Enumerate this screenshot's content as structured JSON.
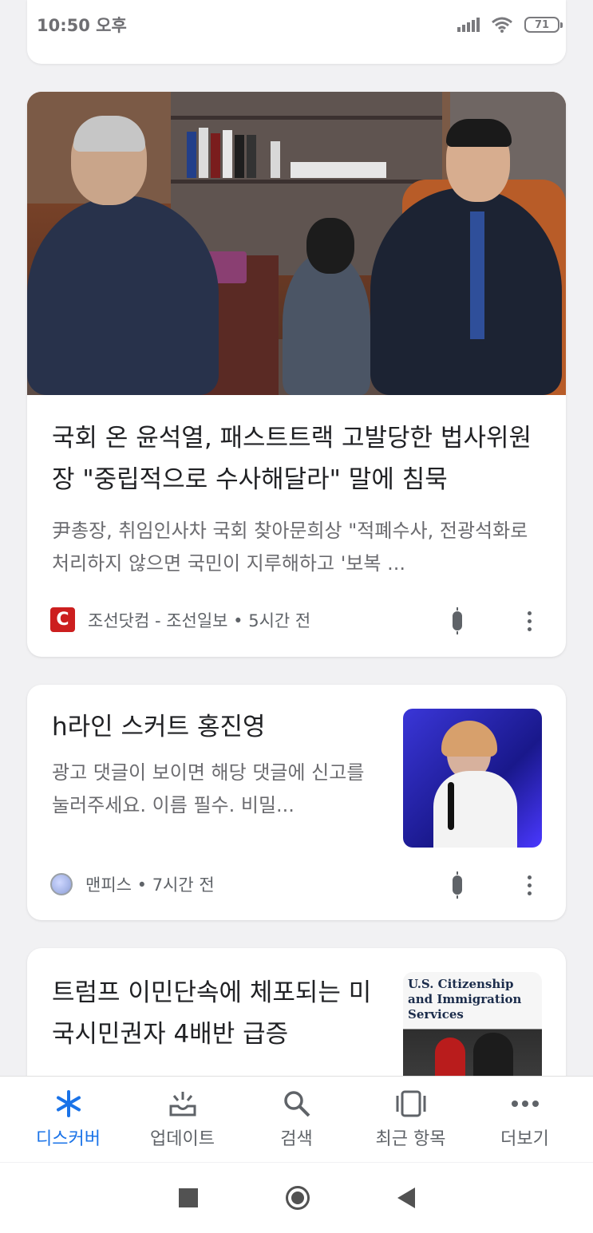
{
  "status_bar": {
    "time": "10:50 오후",
    "battery": "71"
  },
  "feed": {
    "card1": {
      "title": "국회 온 윤석열, 패스트트랙 고발당한 법사위원장 \"중립적으로 수사해달라\" 말에 침묵",
      "snippet": "尹총장, 취임인사차 국회 찾아문희상 \"적폐수사, 전광석화로 처리하지 않으면 국민이 지루해하고 '보복 ...",
      "source": "조선닷컴 - 조선일보 • 5시간 전",
      "logo_letter": "C"
    },
    "card2": {
      "title": "h라인 스커트 홍진영",
      "snippet": "광고 댓글이 보이면 해당 댓글에 신고를 눌러주세요. 이름 필수. 비밀...",
      "source": "맨피스 • 7시간 전"
    },
    "card3": {
      "title": "트럼프 이민단속에 체포되는 미국시민권자 4배반 급증",
      "thumb_text": "U.S. Citizenship and Immigration Services"
    }
  },
  "bottom_nav": {
    "items": [
      {
        "label": "디스커버",
        "icon": "discover-icon",
        "active": true
      },
      {
        "label": "업데이트",
        "icon": "updates-icon",
        "active": false
      },
      {
        "label": "검색",
        "icon": "search-icon",
        "active": false
      },
      {
        "label": "최근 항목",
        "icon": "recent-icon",
        "active": false
      },
      {
        "label": "더보기",
        "icon": "more-icon",
        "active": false
      }
    ]
  },
  "colors": {
    "accent": "#1a73e8",
    "background": "#f1f1f3"
  }
}
